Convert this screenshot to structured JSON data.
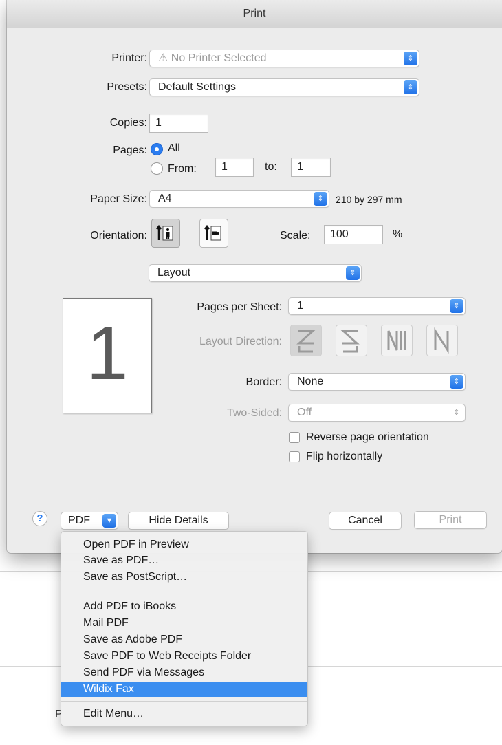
{
  "window": {
    "title": "Print"
  },
  "printer": {
    "label": "Printer:",
    "value": "⚠ No Printer Selected"
  },
  "presets": {
    "label": "Presets:",
    "value": "Default Settings"
  },
  "copies": {
    "label": "Copies:",
    "value": "1"
  },
  "pages": {
    "label": "Pages:",
    "all_label": "All",
    "from_label": "From:",
    "from_value": "1",
    "to_label": "to:",
    "to_value": "1",
    "selected": "All"
  },
  "paper_size": {
    "label": "Paper Size:",
    "value": "A4",
    "dimensions": "210 by 297 mm"
  },
  "orientation": {
    "label": "Orientation:",
    "selected": "portrait"
  },
  "scale": {
    "label": "Scale:",
    "value": "100",
    "unit": "%"
  },
  "section": {
    "value": "Layout"
  },
  "preview": {
    "page_number": "1"
  },
  "layout": {
    "pages_per_sheet": {
      "label": "Pages per Sheet:",
      "value": "1"
    },
    "layout_direction": {
      "label": "Layout Direction:"
    },
    "border": {
      "label": "Border:",
      "value": "None"
    },
    "two_sided": {
      "label": "Two-Sided:",
      "value": "Off"
    },
    "reverse_label": "Reverse page orientation",
    "flip_label": "Flip horizontally"
  },
  "footer": {
    "help": "?",
    "pdf_label": "PDF",
    "hide_details": "Hide Details",
    "cancel": "Cancel",
    "print": "Print"
  },
  "pdf_menu": {
    "group1": [
      "Open PDF in Preview",
      "Save as PDF…",
      "Save as PostScript…"
    ],
    "group2": [
      "Add PDF to iBooks",
      "Mail PDF",
      "Save as Adobe PDF",
      "Save PDF to Web Receipts Folder",
      "Send PDF via Messages",
      "Wildix Fax"
    ],
    "group3": [
      "Edit Menu…"
    ],
    "highlighted": "Wildix Fax"
  },
  "background": {
    "letter": "P"
  },
  "colors": {
    "accent": "#2b7df0",
    "highlight": "#3b8ef0",
    "dialog_bg": "#ececec"
  }
}
